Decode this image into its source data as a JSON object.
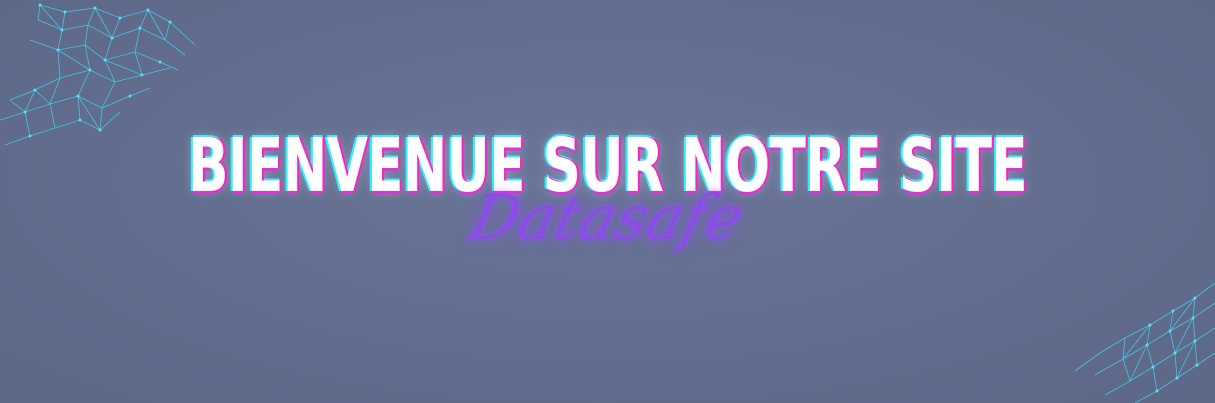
{
  "banner": {
    "headline": "BIENVENUE SUR NOTRE SITE",
    "brand_script": "Datasafe"
  },
  "colors": {
    "background": "#626d8f",
    "headline_text": "#ffffff",
    "glitch_magenta": "#ff1fc8",
    "glitch_cyan": "#2ff0ff",
    "script_purple": "#8c48eb",
    "network_lines": "#3fd3f0"
  },
  "decorations": {
    "top_left": "network-mesh-icon",
    "bottom_right": "network-mesh-icon"
  }
}
